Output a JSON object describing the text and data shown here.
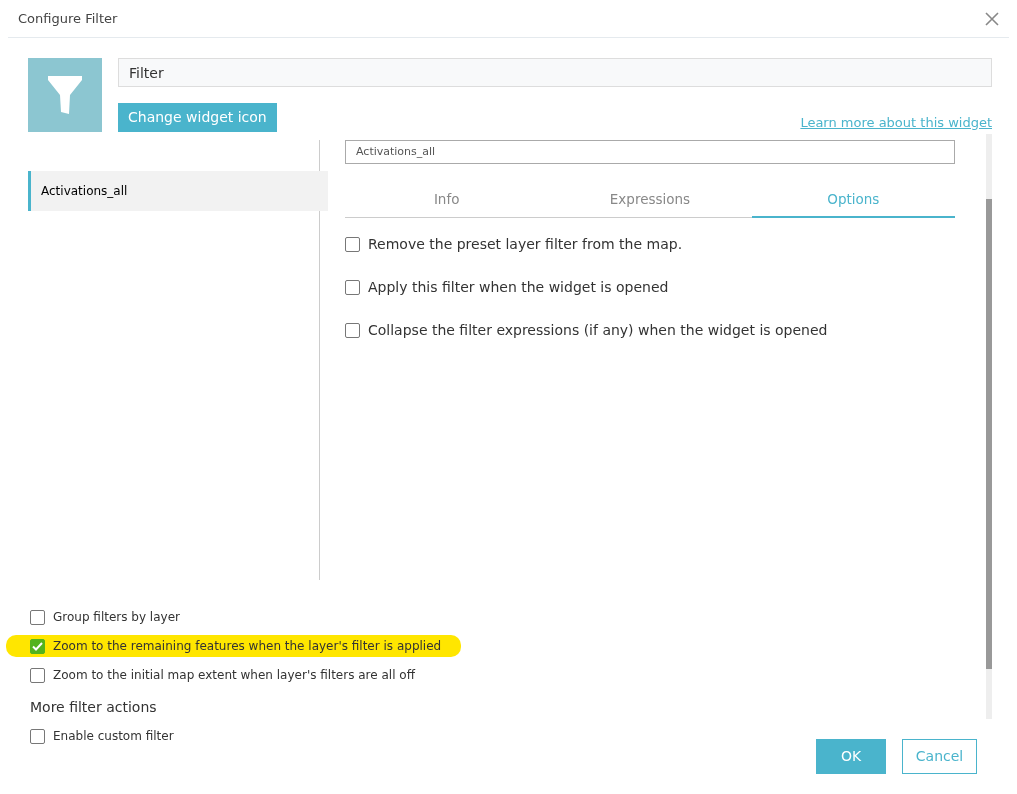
{
  "window": {
    "title": "Configure Filter"
  },
  "widget": {
    "name": "Filter",
    "change_icon_button": "Change widget icon",
    "learn_more_link": "Learn more about this widget"
  },
  "layers": [
    {
      "label": "Activations_all",
      "selected": true
    }
  ],
  "layer_select": {
    "value": "Activations_all"
  },
  "tabs": [
    {
      "label": "Info",
      "selected": false
    },
    {
      "label": "Expressions",
      "selected": false
    },
    {
      "label": "Options",
      "selected": true
    }
  ],
  "layer_options": [
    {
      "label": "Remove the preset layer filter from the map.",
      "checked": false
    },
    {
      "label": "Apply this filter when the widget is opened",
      "checked": false
    },
    {
      "label": "Collapse the filter expressions (if any) when the widget is opened",
      "checked": false
    }
  ],
  "general_options": [
    {
      "label": "Group filters by layer",
      "checked": false,
      "highlighted": false
    },
    {
      "label": "Zoom to the remaining features when the layer's filter is applied",
      "checked": true,
      "highlighted": true
    },
    {
      "label": "Zoom to the initial map extent when layer's filters are all off",
      "checked": false,
      "highlighted": false
    }
  ],
  "more_actions": {
    "heading": "More filter actions",
    "options": [
      {
        "label": "Enable custom filter",
        "checked": false
      }
    ]
  },
  "buttons": [
    {
      "label": "OK",
      "kind": "primary"
    },
    {
      "label": "Cancel",
      "kind": "secondary"
    }
  ]
}
